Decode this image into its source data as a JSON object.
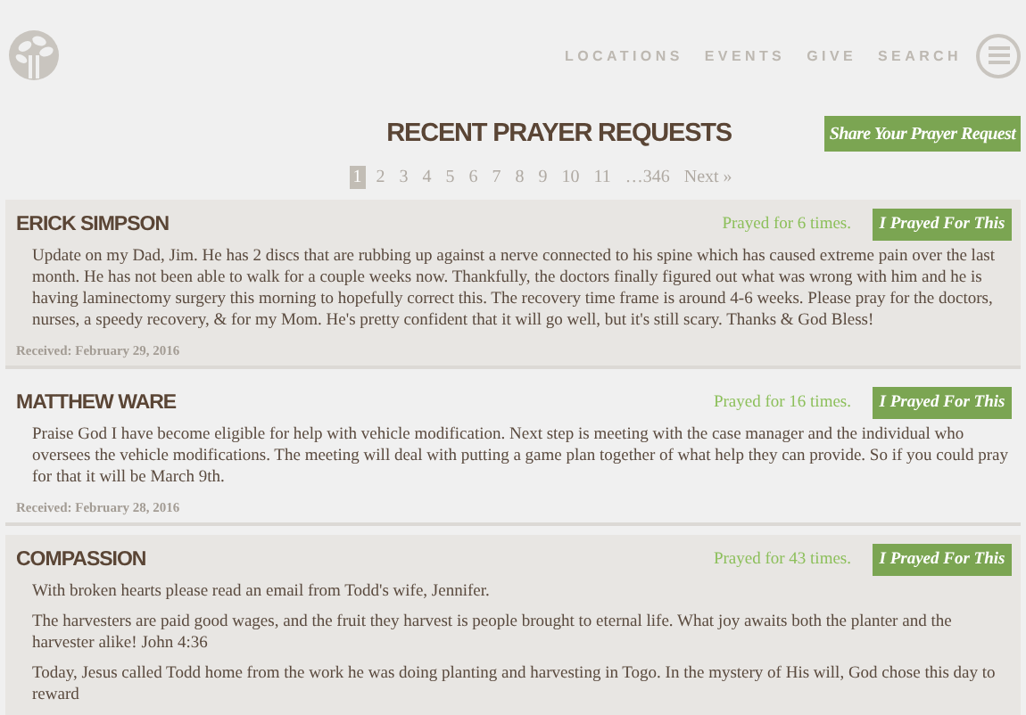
{
  "nav": {
    "items": [
      "LOCATIONS",
      "EVENTS",
      "GIVE",
      "SEARCH"
    ]
  },
  "page_title": "RECENT PRAYER REQUESTS",
  "share_button": "Share Your Prayer Request",
  "pagination": {
    "pages": [
      {
        "label": "1",
        "selected": true
      },
      {
        "label": "2",
        "selected": false
      },
      {
        "label": "3",
        "selected": false
      },
      {
        "label": "4",
        "selected": false
      },
      {
        "label": "5",
        "selected": false
      },
      {
        "label": "6",
        "selected": false
      },
      {
        "label": "7",
        "selected": false
      },
      {
        "label": "8",
        "selected": false
      },
      {
        "label": "9",
        "selected": false
      },
      {
        "label": "10",
        "selected": false
      },
      {
        "label": "11",
        "selected": false
      },
      {
        "label": "…346",
        "selected": false
      }
    ],
    "next": "Next »"
  },
  "requests": [
    {
      "name": "ERICK SIMPSON",
      "count": "Prayed for 6 times.",
      "button": "I Prayed For This",
      "paragraphs": [
        "Update on my Dad, Jim. He has 2 discs that are rubbing up against a nerve connected to his spine which has caused extreme pain over the last month. He has not been able to walk for a couple weeks now. Thankfully, the doctors finally figured out what was wrong with him and he is having laminectomy surgery this morning to hopefully correct this. The recovery time frame is around 4-6 weeks. Please pray for the doctors, nurses, a speedy recovery, & for my Mom. He's pretty confident that it will go well, but it's still scary. Thanks & God Bless!"
      ],
      "received": "Received: February 29, 2016"
    },
    {
      "name": "MATTHEW WARE",
      "count": "Prayed for 16 times.",
      "button": "I Prayed For This",
      "paragraphs": [
        "Praise God I have become eligible for help with vehicle modification. Next step is meeting with the case manager and the individual who oversees the vehicle modifications. The meeting will deal with putting a game plan together of what help they can provide. So if you could pray for that it will be March 9th."
      ],
      "received": "Received: February 28, 2016"
    },
    {
      "name": "COMPASSION",
      "count": "Prayed for 43 times.",
      "button": "I Prayed For This",
      "paragraphs": [
        "With broken hearts please read an email from Todd's wife, Jennifer.",
        "The harvesters are paid good wages, and the fruit they harvest is people brought to eternal life. What joy awaits both the planter and the harvester alike! John 4:36",
        "Today, Jesus called Todd home from the work he was doing planting and harvesting in Togo. In the mystery of His will, God chose this day to reward"
      ]
    }
  ]
}
